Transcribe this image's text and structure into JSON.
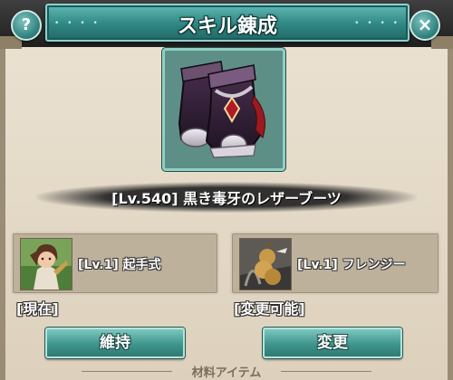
{
  "header": {
    "title": "スキル錬成",
    "help_label": "?",
    "close_label": "×"
  },
  "item": {
    "name": "[Lv.540] 黒き毒牙のレザーブーツ",
    "icon": "leather-boots-icon"
  },
  "skills": {
    "current": {
      "label": "[Lv.1] 起手式",
      "status": "[現在]",
      "portrait": "character-portrait"
    },
    "candidate": {
      "label": "[Lv.1] フレンジー",
      "status": "[変更可能]",
      "portrait": "character-portrait"
    }
  },
  "buttons": {
    "keep_label": "維持",
    "change_label": "変更"
  },
  "materials": {
    "section_label": "材料アイテム"
  },
  "colors": {
    "accent_teal": "#2f8784",
    "panel_beige": "#bdb19c",
    "background": "#e6dccb"
  }
}
